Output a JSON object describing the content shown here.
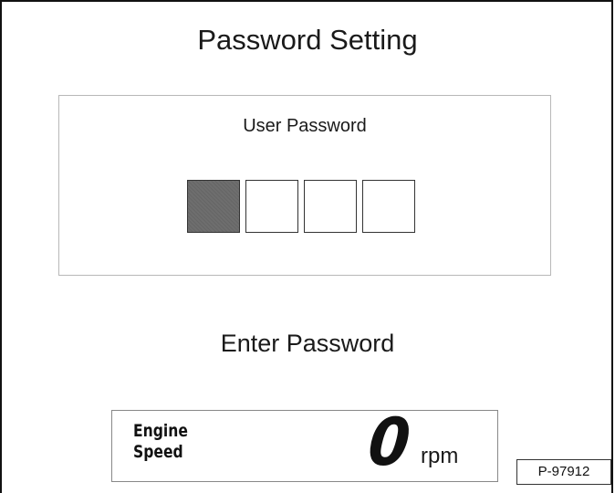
{
  "screen": {
    "title": "Password Setting",
    "prompt": "Enter Password"
  },
  "password_panel": {
    "label": "User Password",
    "digits": [
      {
        "state": "active",
        "value": ""
      },
      {
        "state": "empty",
        "value": ""
      },
      {
        "state": "empty",
        "value": ""
      },
      {
        "state": "empty",
        "value": ""
      }
    ],
    "active_fill_color": "#6e6e6e"
  },
  "engine_speed": {
    "label_line1": "Engine",
    "label_line2": "Speed",
    "value": "0",
    "unit": "rpm"
  },
  "figure_ref": "P-97912"
}
